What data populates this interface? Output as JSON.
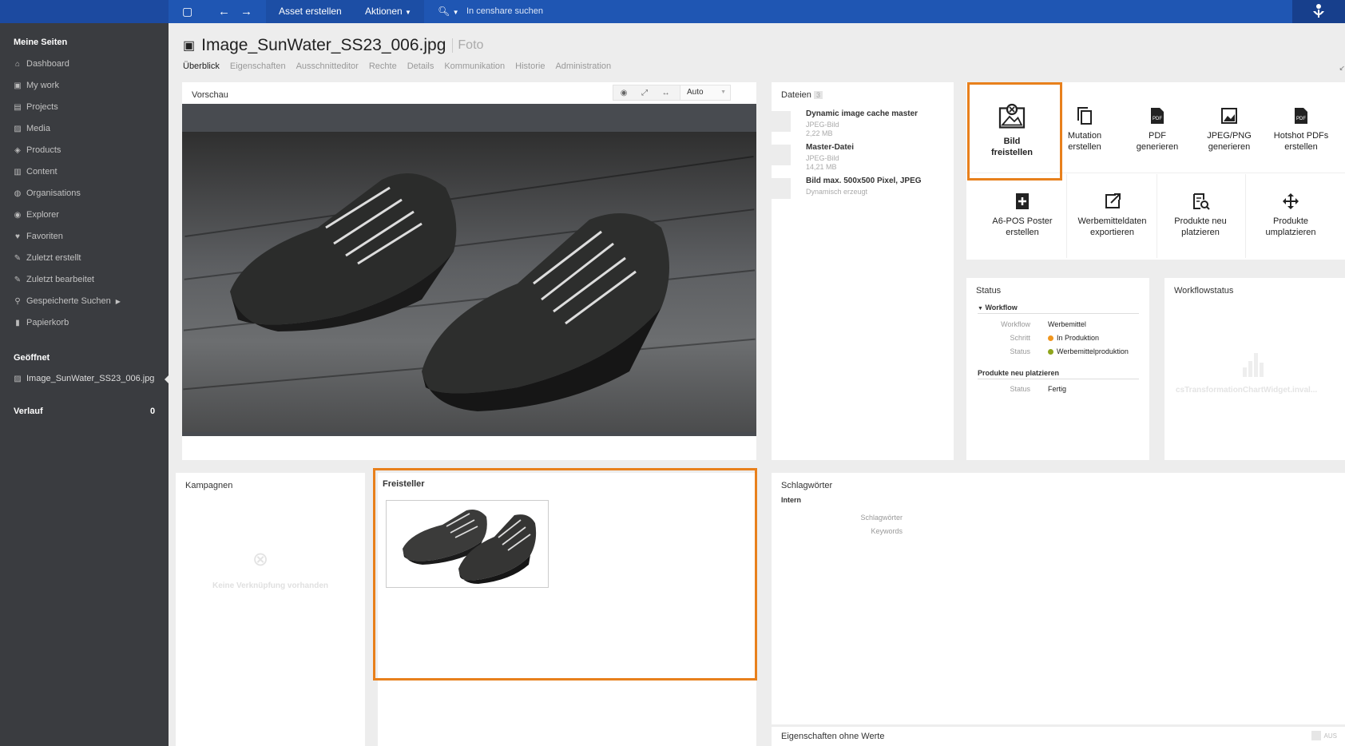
{
  "topbar": {
    "create_asset": "Asset erstellen",
    "actions": "Aktionen",
    "search_placeholder": "In censhare suchen"
  },
  "sidebar": {
    "my_pages": "Meine Seiten",
    "items": [
      "Dashboard",
      "My work",
      "Projects",
      "Media",
      "Products",
      "Content",
      "Organisations",
      "Explorer",
      "Favoriten",
      "Zuletzt erstellt",
      "Zuletzt bearbeitet",
      "Gespeicherte Suchen",
      "Papierkorb"
    ],
    "opened": "Geöffnet",
    "opened_item": "Image_SunWater_SS23_006.jpg",
    "history": "Verlauf",
    "history_count": "0"
  },
  "asset": {
    "title": "Image_SunWater_SS23_006.jpg",
    "type": "Foto"
  },
  "tabs": [
    "Überblick",
    "Eigenschaften",
    "Ausschnitteditor",
    "Rechte",
    "Details",
    "Kommunikation",
    "Historie",
    "Administration"
  ],
  "preview": {
    "title": "Vorschau",
    "zoom": "Auto"
  },
  "files": {
    "title": "Dateien",
    "count": "3",
    "items": [
      {
        "name": "Dynamic image cache master",
        "type": "JPEG-Bild",
        "size": "2,22 MB"
      },
      {
        "name": "Master-Datei",
        "type": "JPEG-Bild",
        "size": "14,21 MB"
      },
      {
        "name": "Bild max. 500x500 Pixel, JPEG",
        "type": "Dynamisch erzeugt",
        "size": ""
      }
    ]
  },
  "actions": {
    "row1": [
      {
        "line1": "Bild",
        "line2": "freistellen"
      },
      {
        "line1": "Mutation",
        "line2": "erstellen"
      },
      {
        "line1": "PDF",
        "line2": "generieren"
      },
      {
        "line1": "JPEG/PNG",
        "line2": "generieren"
      },
      {
        "line1": "Hotshot PDFs",
        "line2": "erstellen"
      }
    ],
    "row2": [
      {
        "line1": "A6-POS Poster",
        "line2": "erstellen"
      },
      {
        "line1": "Werbemitteldaten",
        "line2": "exportieren"
      },
      {
        "line1": "Produkte neu",
        "line2": "platzieren"
      },
      {
        "line1": "Produkte",
        "line2": "umplatzieren"
      }
    ]
  },
  "status": {
    "title": "Status",
    "workflow_header": "Workflow",
    "workflow_label": "Workflow",
    "workflow_value": "Werbemittel",
    "step_label": "Schritt",
    "step_value": "In Produktion",
    "status_label": "Status",
    "status_value": "Werbemittelproduktion",
    "placement_header": "Produkte neu platzieren",
    "placement_status_label": "Status",
    "placement_status_value": "Fertig",
    "colors": {
      "step": "#f0961e",
      "status": "#8fa51c"
    }
  },
  "workflowstatus": {
    "title": "Workflowstatus",
    "placeholder": "csTransformationChartWidget.inval..."
  },
  "campaigns": {
    "title": "Kampagnen",
    "empty": "Keine Verknüpfung vorhanden"
  },
  "freisteller": {
    "title": "Freisteller"
  },
  "keywords": {
    "title": "Schlagwörter",
    "intern": "Intern",
    "label1": "Schlagwörter",
    "label2": "Keywords"
  },
  "props_empty": {
    "title": "Eigenschaften ohne Werte",
    "toggle": "AUS"
  }
}
